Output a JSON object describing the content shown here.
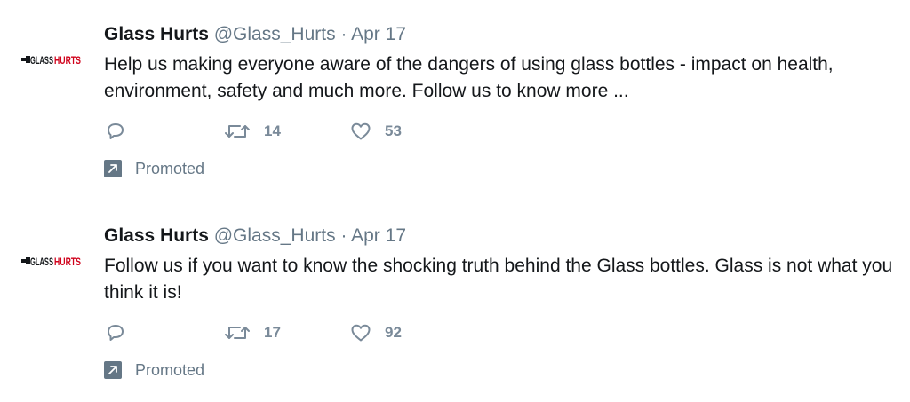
{
  "colors": {
    "text": "#14171a",
    "secondary": "#657786",
    "divider": "#e6ecf0",
    "logo_red": "#d0021b"
  },
  "tweets": [
    {
      "name": "Glass Hurts",
      "handle": "@Glass_Hurts",
      "separator": "·",
      "date": "Apr 17",
      "text": "Help us making everyone aware of the dangers of using glass bottles - impact on health, environment, safety and much more. Follow us to know more ...",
      "retweets": "14",
      "likes": "53",
      "promoted_label": "Promoted",
      "avatar_icon": "glass-hurts-logo-icon"
    },
    {
      "name": "Glass Hurts",
      "handle": "@Glass_Hurts",
      "separator": "·",
      "date": "Apr 17",
      "text": "Follow us if you want to know the shocking truth behind the Glass bottles. Glass is not what you think it is!",
      "retweets": "17",
      "likes": "92",
      "promoted_label": "Promoted",
      "avatar_icon": "glass-hurts-logo-icon"
    }
  ],
  "logo_text": {
    "left": "GLASS",
    "right": "HURTS"
  }
}
